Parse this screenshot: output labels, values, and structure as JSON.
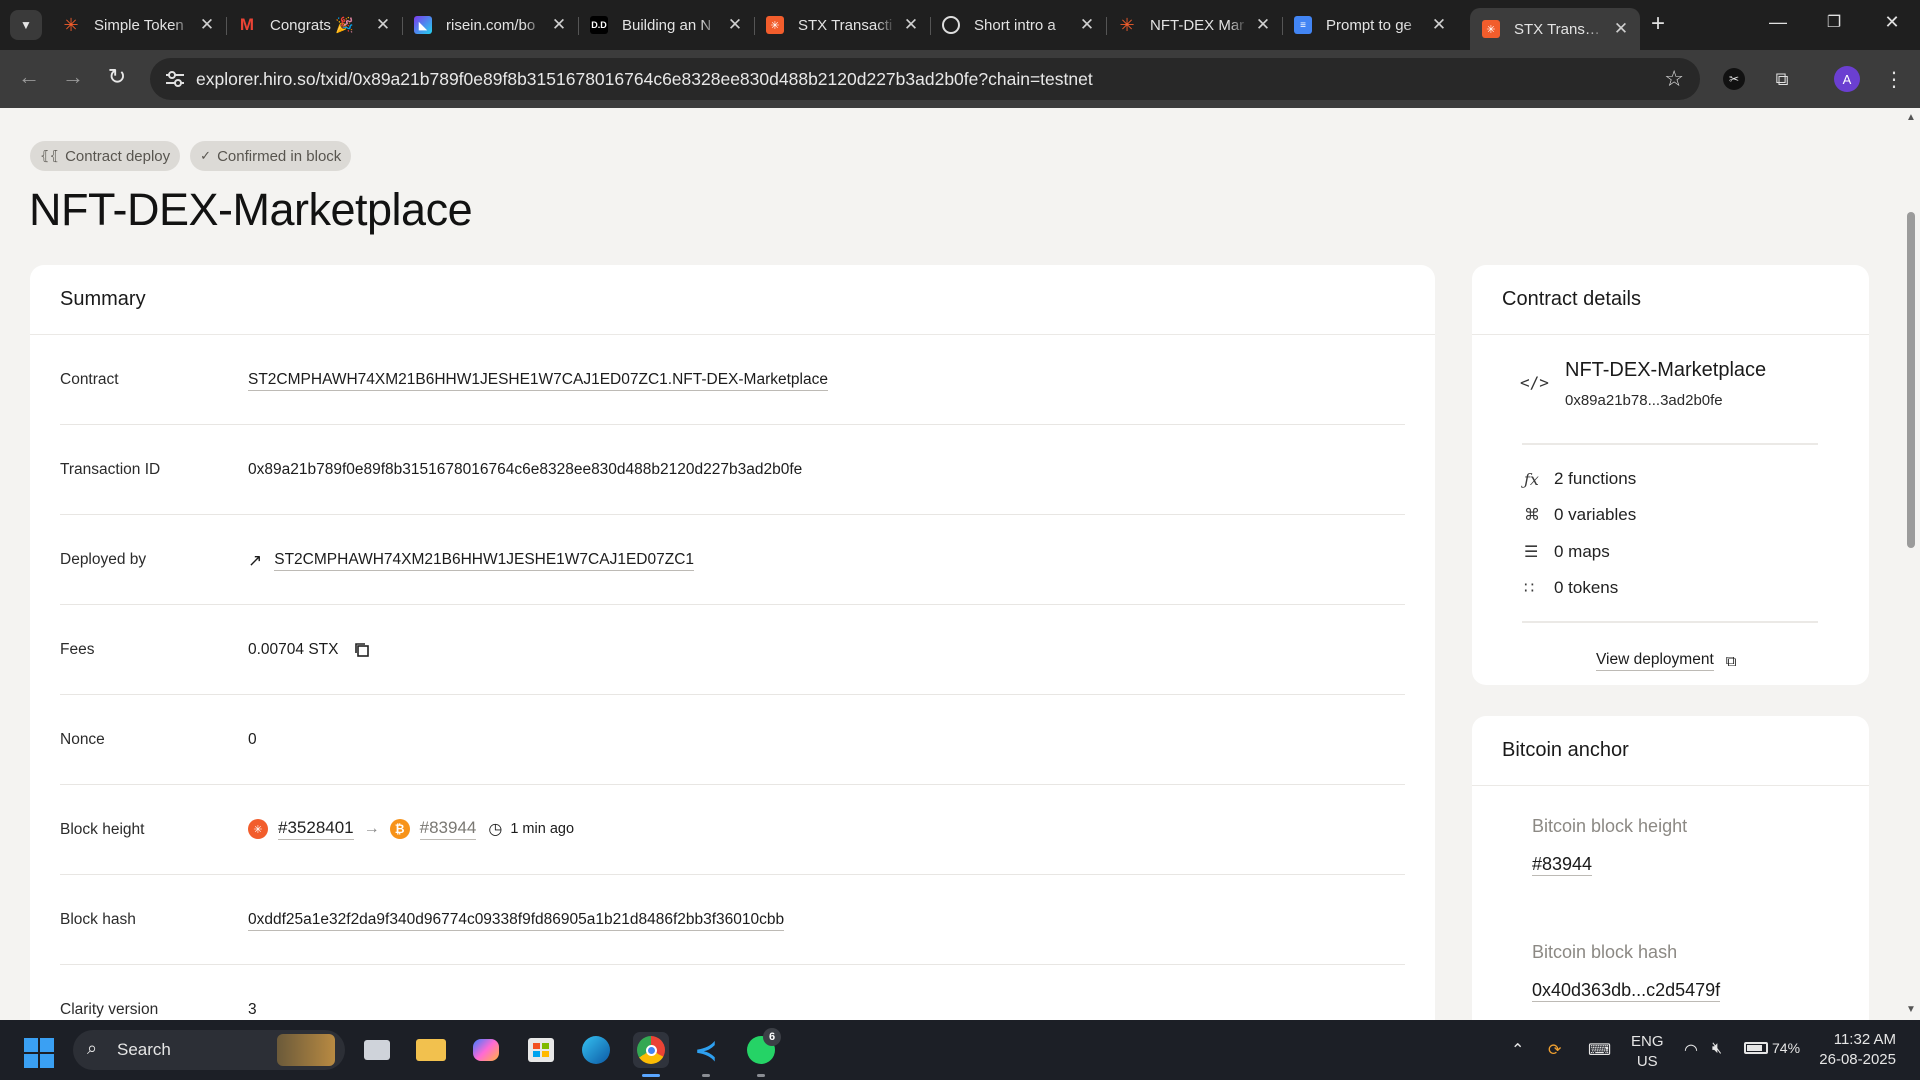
{
  "tabs": [
    {
      "title": "Simple Token",
      "favicon": "asterisk-icon",
      "color": "#f25d2c"
    },
    {
      "title": "Congrats 🎉",
      "favicon": "gmail-icon",
      "color": "#ea4335"
    },
    {
      "title": "risein.com/bo",
      "favicon": "risein-icon",
      "color": "#7c3aed"
    },
    {
      "title": "Building an N",
      "favicon": "dd-icon",
      "color": "#000000"
    },
    {
      "title": "STX Transacti",
      "favicon": "stacks-icon",
      "color": "#f25d2c"
    },
    {
      "title": "Short intro a",
      "favicon": "openai-icon",
      "color": "#1f1f1f"
    },
    {
      "title": "NFT-DEX Mar",
      "favicon": "asterisk-icon",
      "color": "#f25d2c"
    },
    {
      "title": "Prompt to ge",
      "favicon": "docs-icon",
      "color": "#4285f4"
    },
    {
      "title": "STX Transacti",
      "favicon": "stacks-icon",
      "color": "#f25d2c"
    }
  ],
  "address_bar": {
    "url": "explorer.hiro.so/txid/0x89a21b789f0e89f8b3151678016764c6e8328ee830d488b2120d227b3ad2b0fe?chain=testnet",
    "avatar_letter": "A"
  },
  "header": {
    "badges": [
      "Contract deploy",
      "Confirmed in block"
    ],
    "title": "NFT-DEX-Marketplace"
  },
  "summary": {
    "heading": "Summary",
    "rows": {
      "contract": {
        "label": "Contract",
        "value": "ST2CMPHAWH74XM21B6HHW1JESHE1W7CAJ1ED07ZC1.NFT-DEX-Marketplace"
      },
      "txid": {
        "label": "Transaction ID",
        "value": "0x89a21b789f0e89f8b3151678016764c6e8328ee830d488b2120d227b3ad2b0fe"
      },
      "deployed_by": {
        "label": "Deployed by",
        "value": "ST2CMPHAWH74XM21B6HHW1JESHE1W7CAJ1ED07ZC1"
      },
      "fees": {
        "label": "Fees",
        "value": "0.00704 STX"
      },
      "nonce": {
        "label": "Nonce",
        "value": "0"
      },
      "block_height": {
        "label": "Block height",
        "stx_block": "#3528401",
        "btc_block": "#83944",
        "time_ago": "1 min ago"
      },
      "block_hash": {
        "label": "Block hash",
        "value": "0xddf25a1e32f2da9f340d96774c09338f9fd86905a1b21d8486f2bb3f36010cbb"
      },
      "clarity": {
        "label": "Clarity version",
        "value": "3"
      }
    }
  },
  "contract_details": {
    "heading": "Contract details",
    "name": "NFT-DEX-Marketplace",
    "short_hash": "0x89a21b78...3ad2b0fe",
    "stats": [
      "2 functions",
      "0 variables",
      "0 maps",
      "0 tokens"
    ],
    "view_link": "View deployment"
  },
  "bitcoin_anchor": {
    "heading": "Bitcoin anchor",
    "height_label": "Bitcoin block height",
    "height_value": "#83944",
    "hash_label": "Bitcoin block hash",
    "hash_value": "0x40d363db...c2d5479f"
  },
  "taskbar": {
    "search_label": "Search",
    "whatsapp_badge": "6",
    "lang_top": "ENG",
    "lang_bottom": "US",
    "battery": "74%",
    "time": "11:32 AM",
    "date": "26-08-2025"
  },
  "colors": {
    "stacks_orange": "#f25d2c",
    "bitcoin_orange": "#f7931a",
    "accent_blue": "#3aa0f3"
  }
}
